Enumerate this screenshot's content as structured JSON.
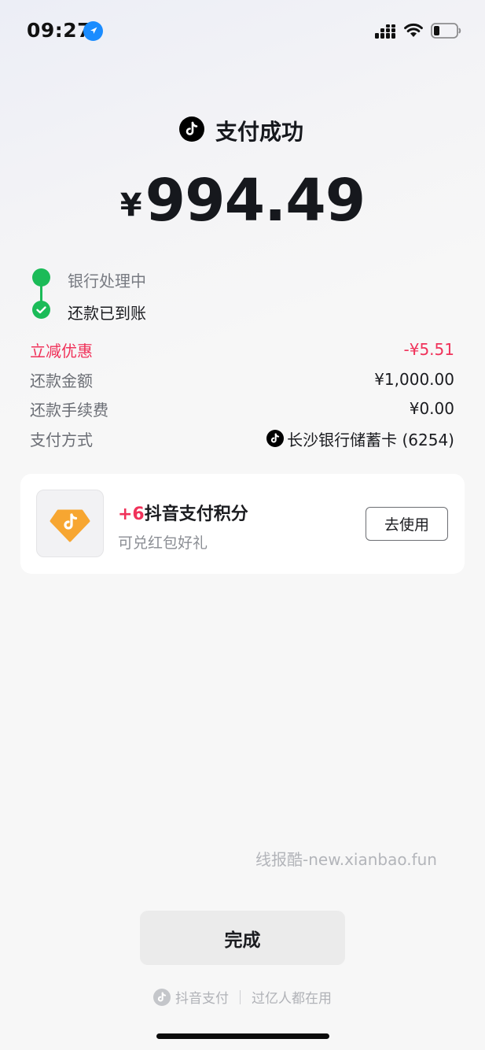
{
  "status_bar": {
    "time": "09:27"
  },
  "header": {
    "title": "支付成功"
  },
  "amount": {
    "currency": "¥",
    "value": "994.49"
  },
  "progress": [
    {
      "label": "银行处理中"
    },
    {
      "label": "还款已到账"
    }
  ],
  "details": [
    {
      "key": "立减优惠",
      "value": "-¥5.51"
    },
    {
      "key": "还款金额",
      "value": "¥1,000.00"
    },
    {
      "key": "还款手续费",
      "value": "¥0.00"
    },
    {
      "key": "支付方式",
      "value": "长沙银行储蓄卡 (6254)"
    }
  ],
  "points_card": {
    "plus": "+6",
    "title": "抖音支付积分",
    "subtitle": "可兑红包好礼",
    "button": "去使用"
  },
  "watermark": "线报酷-new.xianbao.fun",
  "done_button": "完成",
  "footer": {
    "brand": "抖音支付",
    "slogan": "过亿人都在用"
  },
  "colors": {
    "accent_red": "#f0325a",
    "success_green": "#1bbb58",
    "points_orange": "#f7a631"
  },
  "icons": [
    "location-arrow-icon",
    "cellular-signal-icon",
    "wifi-icon",
    "battery-icon",
    "douyin-logo-icon",
    "check-icon",
    "points-gem-icon"
  ]
}
